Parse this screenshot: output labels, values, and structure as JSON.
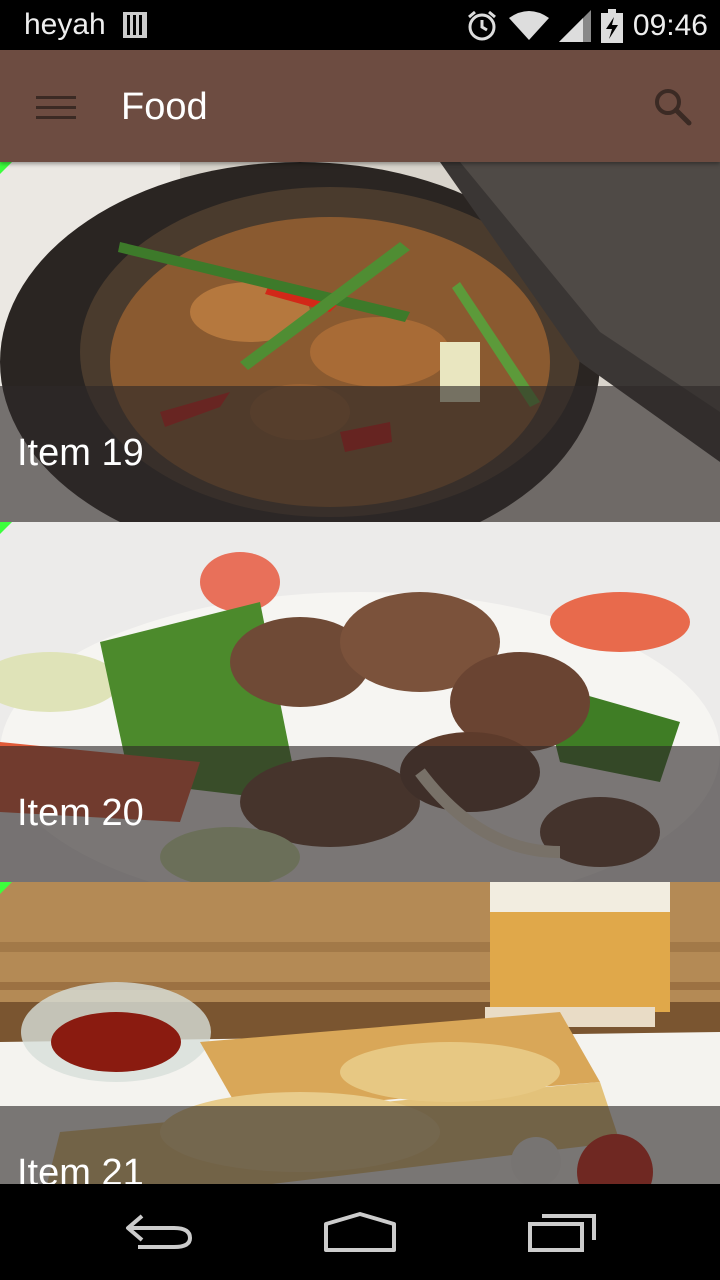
{
  "status_bar": {
    "carrier": "heyah",
    "time": "09:46",
    "icons": [
      "sim-icon",
      "alarm-icon",
      "wifi-icon",
      "signal-icon",
      "battery-charging-icon"
    ]
  },
  "app_bar": {
    "title": "Food",
    "left_icon": "menu-icon",
    "right_icon": "search-icon",
    "color": "#6d4c41"
  },
  "items": [
    {
      "label": "Item 19",
      "image": "stir-fry-pot-photo"
    },
    {
      "label": "Item 20",
      "image": "beef-salad-photo"
    },
    {
      "label": "Item 21",
      "image": "pizza-bread-beer-photo"
    }
  ],
  "nav_bar": {
    "icons": [
      "back-icon",
      "home-icon",
      "recents-icon"
    ]
  }
}
